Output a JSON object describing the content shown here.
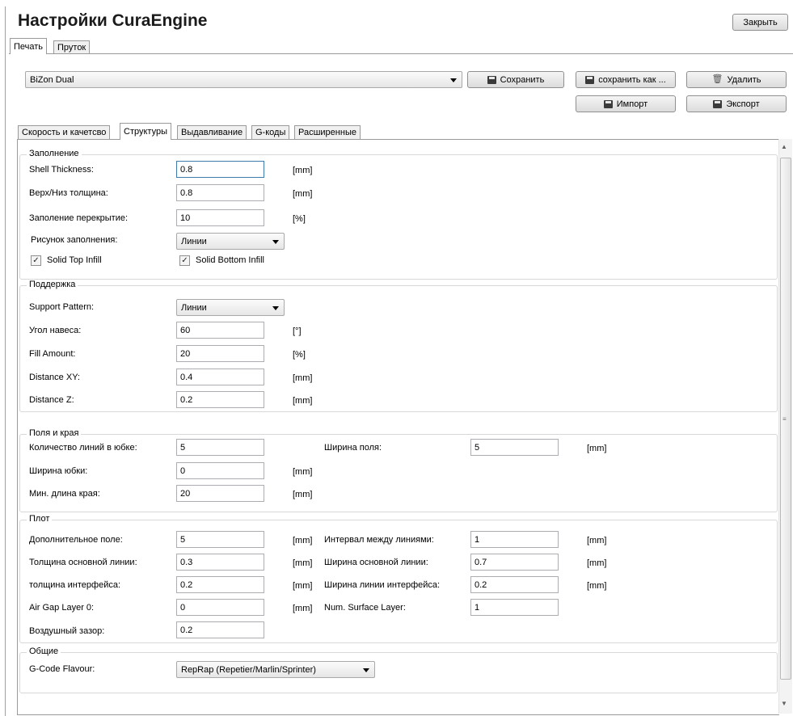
{
  "title": "Настройки CuraEngine",
  "close_label": "Закрыть",
  "top_tabs": [
    "Печать",
    "Пруток"
  ],
  "profile": {
    "selected": "BiZon Dual"
  },
  "buttons": {
    "save": "Сохранить",
    "save_as": "сохранить как ...",
    "delete": "Удалить",
    "import": "Импорт",
    "export": "Экспорт"
  },
  "tabs": [
    "Скорость и качетсво",
    "Структуры",
    "Выдавливание",
    "G-коды",
    "Расширенные"
  ],
  "active_tab": "Структуры",
  "infill": {
    "title": "Заполнение",
    "shell_thickness": {
      "label": "Shell Thickness:",
      "value": "0.8",
      "unit": "[mm]"
    },
    "top_bottom": {
      "label": "Верх/Низ толщина:",
      "value": "0.8",
      "unit": "[mm]"
    },
    "overlap": {
      "label": "Заполение перекрытие:",
      "value": "10",
      "unit": "[%]"
    },
    "pattern": {
      "label": "Рисунок заполнения:",
      "value": "Линии"
    },
    "solid_top": {
      "label": "Solid Top Infill",
      "checked": true
    },
    "solid_bottom": {
      "label": "Solid Bottom Infill",
      "checked": true
    }
  },
  "support": {
    "title": "Поддержка",
    "pattern": {
      "label": "Support Pattern:",
      "value": "Линии"
    },
    "angle": {
      "label": "Угол навеса:",
      "value": "60",
      "unit": "[°]"
    },
    "fill": {
      "label": "Fill Amount:",
      "value": "20",
      "unit": "[%]"
    },
    "dxy": {
      "label": "Distance XY:",
      "value": "0.4",
      "unit": "[mm]"
    },
    "dz": {
      "label": "Distance Z:",
      "value": "0.2",
      "unit": "[mm]"
    }
  },
  "skirt": {
    "title": "Поля и края",
    "lines": {
      "label": "Количество линий в юбке:",
      "value": "5"
    },
    "brim_width": {
      "label": "Ширина поля:",
      "value": "5",
      "unit": "[mm]"
    },
    "skirt_width": {
      "label": "Ширина юбки:",
      "value": "0",
      "unit": "[mm]"
    },
    "min_length": {
      "label": "Мин. длина края:",
      "value": "20",
      "unit": "[mm]"
    }
  },
  "raft": {
    "title": "Плот",
    "extra_margin": {
      "label": "Дополнительное поле:",
      "value": "5",
      "unit": "[mm]"
    },
    "line_spacing": {
      "label": "Интервал между линиями:",
      "value": "1",
      "unit": "[mm]"
    },
    "base_thickness": {
      "label": "Толщина основной линии:",
      "value": "0.3",
      "unit": "[mm]"
    },
    "base_width": {
      "label": "Ширина основной линии:",
      "value": "0.7",
      "unit": "[mm]"
    },
    "iface_thickness": {
      "label": "толщина интерфейса:",
      "value": "0.2",
      "unit": "[mm]"
    },
    "iface_width": {
      "label": "Ширина линии интерфейса:",
      "value": "0.2",
      "unit": "[mm]"
    },
    "air_gap0": {
      "label": "Air Gap Layer 0:",
      "value": "0",
      "unit": "[mm]"
    },
    "surface_layers": {
      "label": "Num. Surface Layer:",
      "value": "1"
    },
    "air_gap": {
      "label": "Воздушный зазор:",
      "value": "0.2"
    }
  },
  "general": {
    "title": "Общие",
    "flavour": {
      "label": "G-Code Flavour:",
      "value": "RepRap (Repetier/Marlin/Sprinter)"
    }
  }
}
